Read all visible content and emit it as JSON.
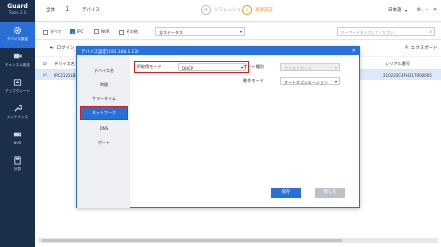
{
  "app": {
    "brand_line1": "Guard",
    "brand_line2": "Tools 2.0"
  },
  "sidebar": {
    "items": [
      {
        "label": "デバイス設定",
        "icon": "gear-icon",
        "active": true
      },
      {
        "label": "チャンネル設定",
        "icon": "channel-settings-icon",
        "active": false
      },
      {
        "label": "アップグレード",
        "icon": "upgrade-icon",
        "active": false
      },
      {
        "label": "メンテナンス",
        "icon": "maintenance-icon",
        "active": false
      },
      {
        "label": "NVR",
        "icon": "nvr-icon",
        "active": false
      },
      {
        "label": "計算",
        "icon": "calculator-icon",
        "active": false
      }
    ]
  },
  "topbar": {
    "total_label": "全体",
    "total_count": "1",
    "device_label": "デバイス",
    "refresh_label": "リフレッシュ",
    "activate_label": "高速認証",
    "language": "日本語"
  },
  "filters": {
    "all": "すべて",
    "ipc": "IPC",
    "nvr": "NVR",
    "other": "その他",
    "status_value": "全ステータス",
    "search_placeholder": "キーワードを入力してください"
  },
  "actions": {
    "login": "ログイン",
    "export": "エクスポート"
  },
  "table": {
    "headers": {
      "name": "デバイス名",
      "serial": "シリアル番号"
    },
    "rows": [
      {
        "index": "1",
        "name": "IPC2122LB-A...",
        "serial": "210235C4FH317000005"
      }
    ]
  },
  "modal": {
    "title": "デバイス設定(192.168.1.13)",
    "side_items": [
      "デバイス名",
      "時間",
      "サマータイム",
      "ネットワーク",
      "DNS",
      "ポート"
    ],
    "active_index": 3,
    "fields": {
      "ip_mode_label": "IP取得モード",
      "ip_mode_value": "DHCP",
      "port_type_label": "ポート種別",
      "port_type_value": "ファストポート",
      "work_mode_label": "動作モード",
      "work_mode_value": "オートネゴシエーション"
    },
    "save": "保存",
    "close": "閉じる"
  },
  "colors": {
    "accent": "#2a6fd6",
    "sidebar": "#1b2f4a",
    "highlight": "#d42020",
    "activate": "#f0932b"
  }
}
